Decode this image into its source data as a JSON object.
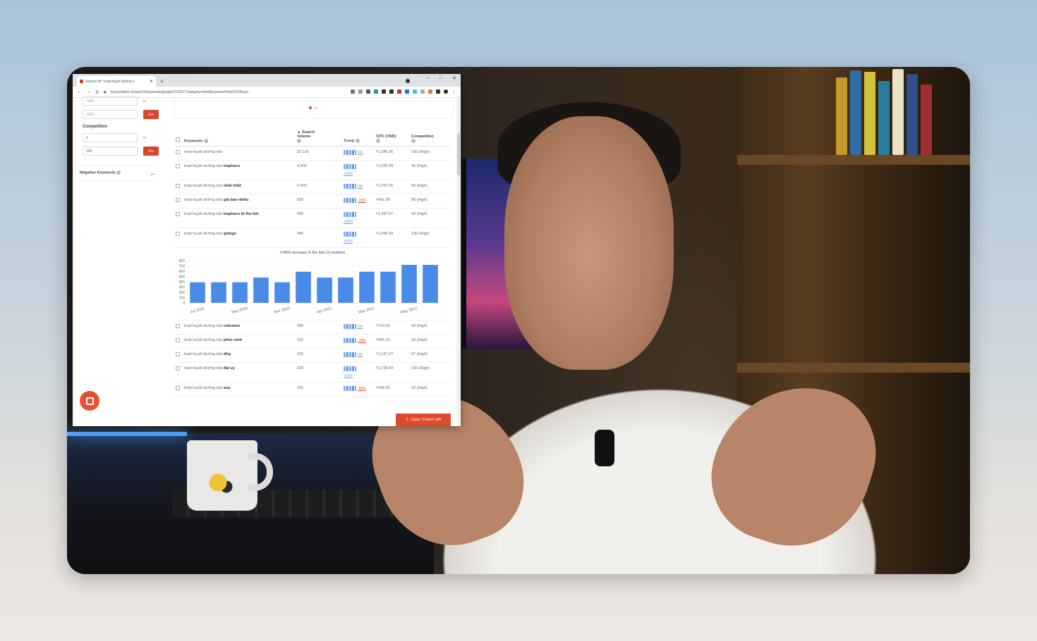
{
  "browser": {
    "tab_title": "Search for \"hoạt huyết dưỡng n",
    "url": "keywordtool.io/search/keywords/google/2155127category=web&keyword=hoat%20huye..."
  },
  "sidebar": {
    "partial_value_top": "7000",
    "vol_max_placeholder": "1000",
    "to_label": "to",
    "go_label": "Go",
    "competition_label": "Competition",
    "comp_min": "1",
    "comp_max": "100",
    "negative_keywords_label": "Negative Keywords"
  },
  "table": {
    "headers": {
      "keywords": "Keywords",
      "search_volume_line1": "Search",
      "search_volume_line2": "Volume",
      "trend": "Trend",
      "cpc": "CPC (VND)",
      "competition": "Competition"
    },
    "prefix": "hoạt huyết dưỡng não",
    "rows_top": [
      {
        "suffix": "",
        "volume": "33,100",
        "trend": "0%",
        "trend_kind": "inline",
        "cpc": "₫1,386.36",
        "comp": "100 (High)"
      },
      {
        "suffix": "traphaco",
        "volume": "4,400",
        "trend": "+53%",
        "trend_kind": "pos",
        "cpc": "₫1,035.59",
        "comp": "95 (High)"
      },
      {
        "suffix": "nhất nhất",
        "volume": "2,400",
        "trend": "0%",
        "trend_kind": "inline",
        "cpc": "₫1,267.05",
        "comp": "99 (High)"
      },
      {
        "suffix": "giá bao nhiêu",
        "volume": "590",
        "trend": "-33%",
        "trend_kind": "neg",
        "cpc": "₫941.59",
        "comp": "98 (High)"
      },
      {
        "suffix": "traphaco bị thu hồi",
        "volume": "590",
        "trend": "+85%",
        "trend_kind": "pos",
        "cpc": "₫1,387.67",
        "comp": "94 (High)"
      },
      {
        "suffix": "ginkgo",
        "volume": "480",
        "trend": "+85%",
        "trend_kind": "pos",
        "cpc": "₫1,496.39",
        "comp": "100 (High)"
      }
    ],
    "rows_bottom": [
      {
        "suffix": "cebraton",
        "volume": "390",
        "trend": "0%",
        "trend_kind": "inline",
        "cpc": "₫719.54",
        "comp": "94 (High)"
      },
      {
        "suffix": "phúc vinh",
        "volume": "320",
        "trend": "-19%",
        "trend_kind": "neg",
        "cpc": "₫835.10",
        "comp": "93 (High)"
      },
      {
        "suffix": "dhg",
        "volume": "320",
        "trend": "0%",
        "trend_kind": "inline",
        "cpc": "₫1,147.27",
        "comp": "87 (High)"
      },
      {
        "suffix": "đại uy",
        "volume": "320",
        "trend": "+53%",
        "trend_kind": "pos",
        "cpc": "₫1,728.94",
        "comp": "100 (High)"
      },
      {
        "suffix": "acp",
        "volume": "260",
        "trend": "-56%",
        "trend_kind": "neg",
        "cpc": "₫648.05",
        "comp": "93 (High)"
      }
    ]
  },
  "export_label": "Copy / Export all",
  "chart_data": {
    "type": "bar",
    "title": "(+85% increase in the last 12 months)",
    "categories": [
      "Jul 2020",
      "Aug 2020",
      "Sep 2020",
      "Oct 2020",
      "Nov 2020",
      "Dec 2020",
      "Jan 2021",
      "Feb 2021",
      "Mar 2021",
      "Apr 2021",
      "May 2021",
      "Jun 2021"
    ],
    "x_tick_labels": [
      "Jul 2020",
      "Sep 2020",
      "Nov 2020",
      "Jan 2021",
      "Mar 2021",
      "May 2021"
    ],
    "values": [
      390,
      390,
      390,
      480,
      390,
      590,
      480,
      480,
      590,
      590,
      720,
      720
    ],
    "ylim": [
      0,
      800
    ],
    "y_ticks": [
      "0",
      "100",
      "200",
      "300",
      "400",
      "500",
      "600",
      "700",
      "800"
    ],
    "bar_color": "#4a8ae8",
    "grid": true
  },
  "colors": {
    "accent": "#d9452a",
    "bar": "#4a8ae8"
  }
}
